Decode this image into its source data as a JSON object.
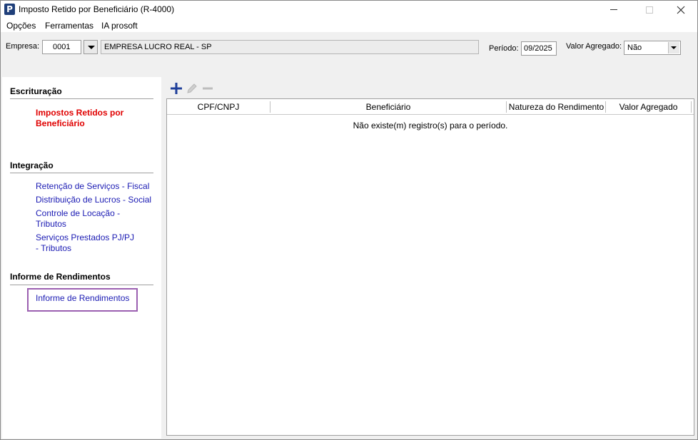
{
  "window": {
    "title": "Imposto Retido por Beneficiário (R-4000)",
    "icon_letter": "P",
    "buttons": {
      "minimize": "minimize-icon",
      "maximize": "maximize-icon",
      "close": "close-icon"
    }
  },
  "menu": {
    "items": [
      "Opções",
      "Ferramentas",
      "IA prosoft"
    ]
  },
  "filters": {
    "empresa_label": "Empresa:",
    "empresa_code": "0001",
    "empresa_name": "EMPRESA LUCRO REAL - SP",
    "periodo_label": "Período:",
    "periodo_value": "09/2025",
    "valor_agregado_label": "Valor Agregado:",
    "valor_agregado_value": "Não"
  },
  "sidebar": {
    "sections": [
      {
        "title": "Escrituração",
        "items": [
          "Impostos Retidos por Beneficiário"
        ]
      },
      {
        "title": "Integração",
        "items": [
          "Retenção de Serviços - Fiscal",
          "Distribuição de Lucros - Social",
          "Controle de Locação - Tributos",
          "Serviços Prestados PJ/PJ - Tributos"
        ]
      },
      {
        "title": "Informe de Rendimentos",
        "items": [
          "Informe de Rendimentos"
        ]
      }
    ]
  },
  "grid": {
    "columns": [
      "CPF/CNPJ",
      "Beneficiário",
      "Natureza do Rendimento",
      "Valor Agregado"
    ],
    "empty_message": "Não existe(m) registro(s) para o período.",
    "toolbar_icons": [
      "add-icon",
      "edit-icon",
      "remove-icon"
    ]
  },
  "colors": {
    "active_link": "#e00000",
    "link": "#1a1ab3",
    "highlight_border": "#9b5fb0",
    "icon_blue": "#1f3f7a"
  }
}
